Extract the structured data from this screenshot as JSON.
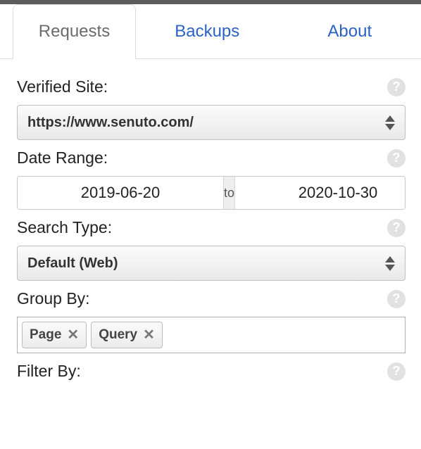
{
  "tabs": {
    "requests": "Requests",
    "backups": "Backups",
    "about": "About"
  },
  "verified_site": {
    "label": "Verified Site:",
    "value": "https://www.senuto.com/"
  },
  "date_range": {
    "label": "Date Range:",
    "from": "2019-06-20",
    "sep": "to",
    "to": "2020-10-30"
  },
  "search_type": {
    "label": "Search Type:",
    "value": "Default (Web)"
  },
  "group_by": {
    "label": "Group By:",
    "tags": [
      "Page",
      "Query"
    ]
  },
  "filter_by": {
    "label": "Filter By:"
  },
  "help_glyph": "?"
}
